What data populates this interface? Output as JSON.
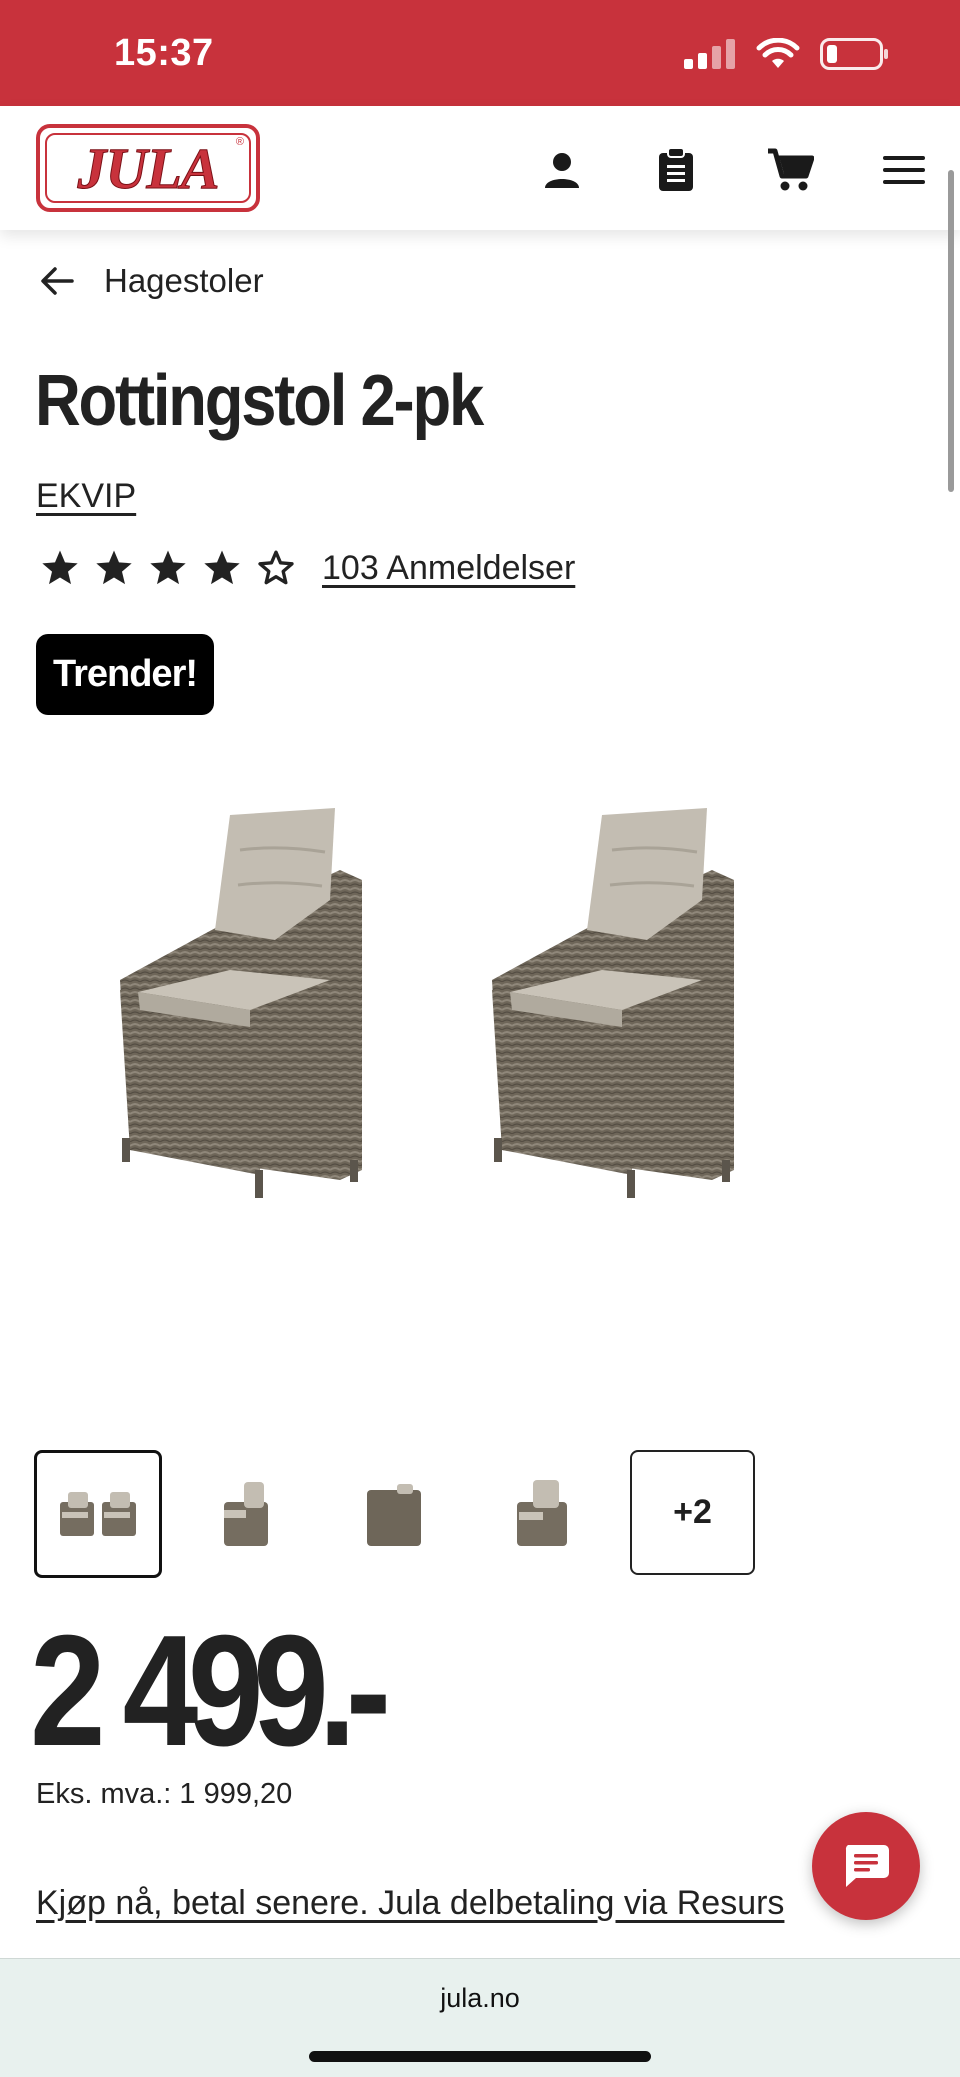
{
  "status_bar": {
    "time": "15:37",
    "background": "#c8323c"
  },
  "header": {
    "logo_text": "JULA",
    "logo_reg": "®",
    "icons": [
      "account-icon",
      "shopping-list-icon",
      "cart-icon",
      "menu-icon"
    ]
  },
  "breadcrumb": {
    "back_label": "Hagestoler"
  },
  "product": {
    "title": "Rottingstol 2-pk",
    "brand": "EKVIP",
    "rating": 4,
    "rating_max": 5,
    "reviews_label": "103 Anmeldelser",
    "badge": "Trender!",
    "price": "2 499.-",
    "ex_vat": "Eks. mva.: 1 999,20",
    "installment_link": "Kjøp nå, betal senere. Jula delbetaling via Resurs"
  },
  "gallery": {
    "more_label": "+2"
  },
  "browser": {
    "url": "jula.no"
  },
  "colors": {
    "brand_red": "#c8323c",
    "text": "#222222",
    "badge_bg": "#000000"
  }
}
